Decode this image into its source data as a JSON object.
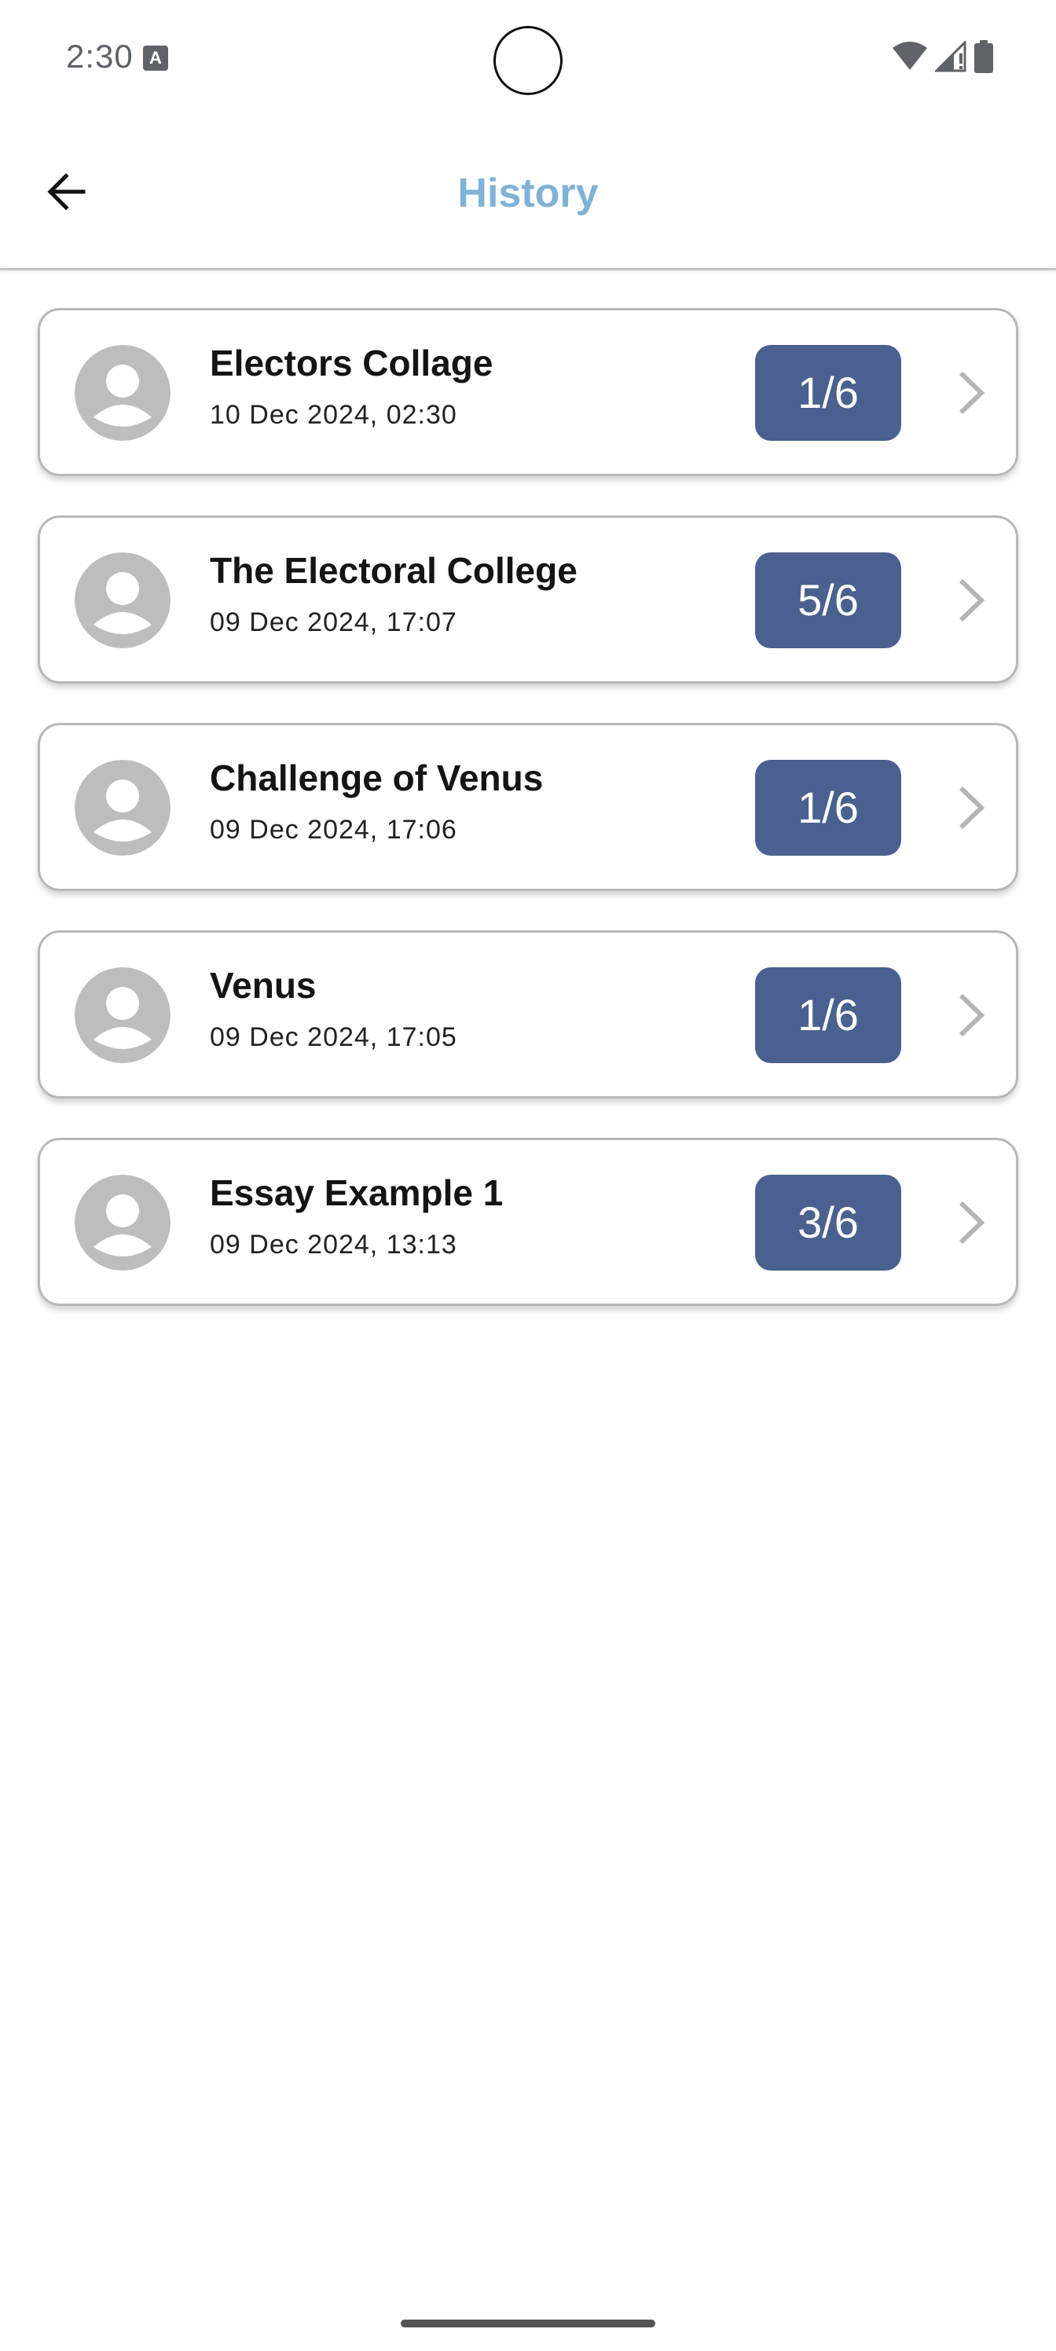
{
  "status_bar": {
    "time": "2:30",
    "icons": [
      "notification-a-icon",
      "wifi-icon",
      "signal-icon",
      "battery-icon"
    ]
  },
  "app_bar": {
    "title": "History",
    "back_icon": "arrow-left-icon",
    "title_color": "#7fb2d6"
  },
  "history": {
    "items": [
      {
        "title": "Electors Collage",
        "date": "10 Dec 2024, 02:30",
        "score": "1/6"
      },
      {
        "title": "The Electoral College",
        "date": "09 Dec 2024, 17:07",
        "score": "5/6"
      },
      {
        "title": "Challenge of Venus",
        "date": "09 Dec 2024, 17:06",
        "score": "1/6"
      },
      {
        "title": "Venus",
        "date": "09 Dec 2024, 17:05",
        "score": "1/6"
      },
      {
        "title": "Essay Example 1",
        "date": "09 Dec 2024, 13:13",
        "score": "3/6"
      }
    ]
  },
  "colors": {
    "badge": "#4a618f",
    "card_border": "#b8b8b8",
    "avatar": "#bdbdbd"
  }
}
